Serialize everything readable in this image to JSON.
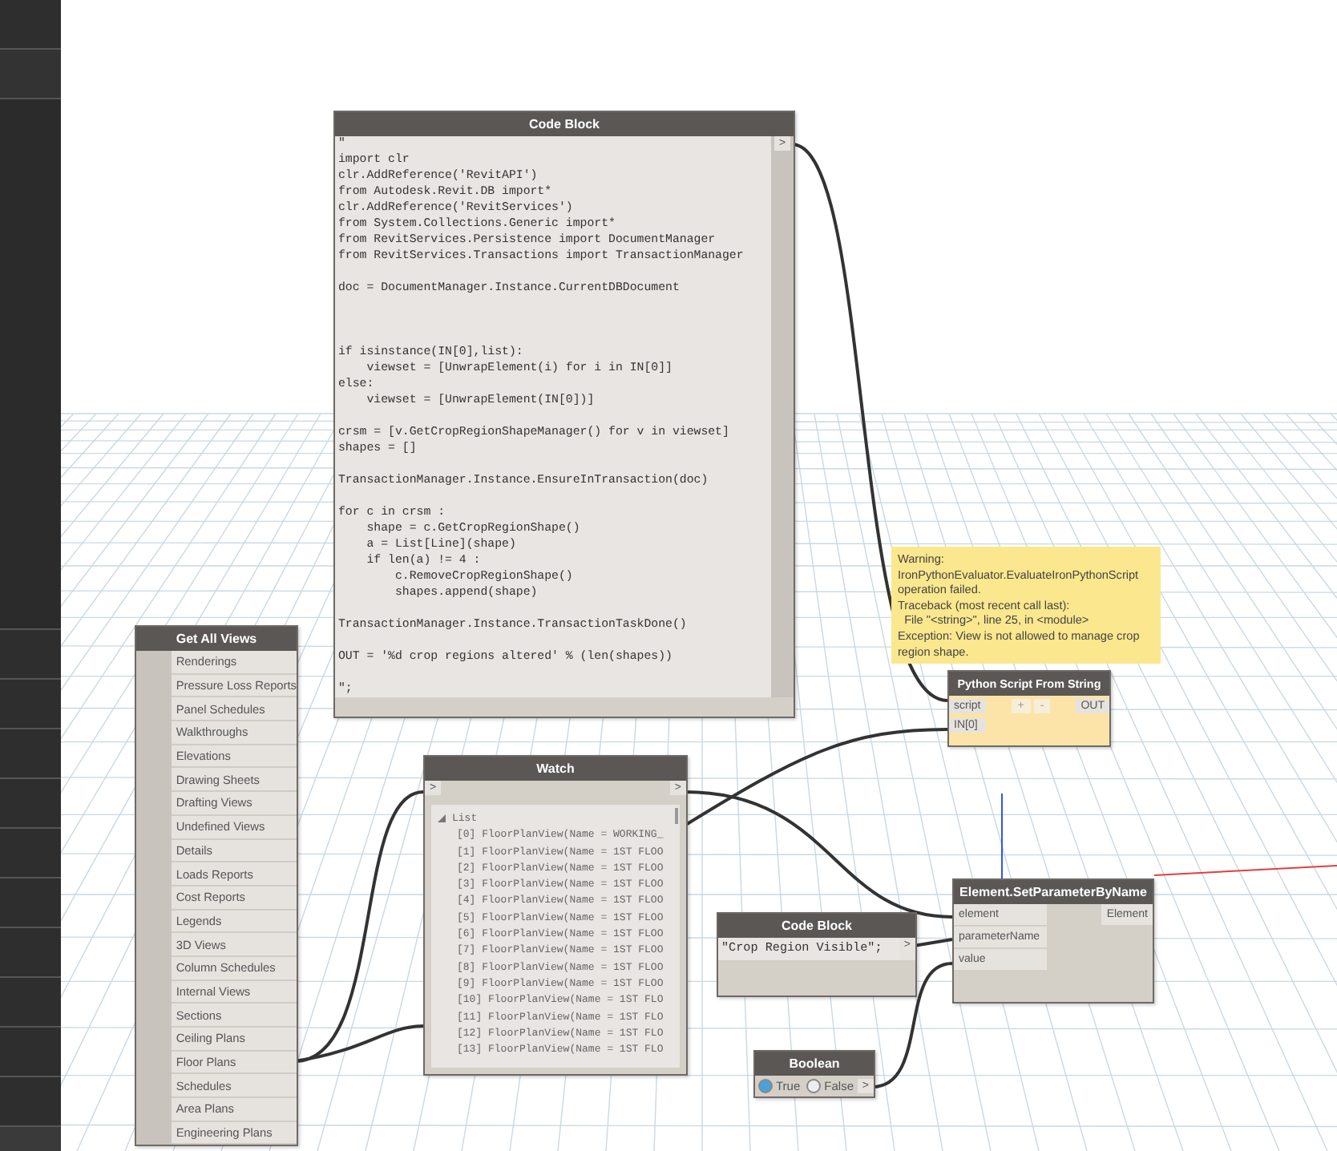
{
  "code_block": {
    "title": "Code Block",
    "output_port": ">",
    "code": "\"\nimport clr\nclr.AddReference('RevitAPI')\nfrom Autodesk.Revit.DB import*\nclr.AddReference('RevitServices')\nfrom System.Collections.Generic import*\nfrom RevitServices.Persistence import DocumentManager\nfrom RevitServices.Transactions import TransactionManager\n\ndoc = DocumentManager.Instance.CurrentDBDocument\n\n\n\nif isinstance(IN[0],list):\n    viewset = [UnwrapElement(i) for i in IN[0]]\nelse:\n    viewset = [UnwrapElement(IN[0])]\n\ncrsm = [v.GetCropRegionShapeManager() for v in viewset]\nshapes = []\n\nTransactionManager.Instance.EnsureInTransaction(doc)\n\nfor c in crsm :\n    shape = c.GetCropRegionShape()\n    a = List[Line](shape)\n    if len(a) != 4 :\n        c.RemoveCropRegionShape()\n        shapes.append(shape)\n\nTransactionManager.Instance.TransactionTaskDone()\n\nOUT = '%d crop regions altered' % (len(shapes))\n\n\";"
  },
  "get_all_views": {
    "title": "Get All Views",
    "items": [
      {
        "label": "Renderings"
      },
      {
        "label": "Pressure Loss Reports"
      },
      {
        "label": "Panel Schedules"
      },
      {
        "label": "Walkthroughs"
      },
      {
        "label": "Elevations"
      },
      {
        "label": "Drawing Sheets"
      },
      {
        "label": "Drafting Views"
      },
      {
        "label": "Undefined Views"
      },
      {
        "label": "Details"
      },
      {
        "label": "Loads Reports"
      },
      {
        "label": "Cost Reports"
      },
      {
        "label": "Legends"
      },
      {
        "label": "3D Views"
      },
      {
        "label": "Column Schedules"
      },
      {
        "label": "Internal Views"
      },
      {
        "label": "Sections"
      },
      {
        "label": "Ceiling Plans"
      },
      {
        "label": "Floor Plans"
      },
      {
        "label": "Schedules"
      },
      {
        "label": "Area Plans"
      },
      {
        "label": "Engineering Plans"
      }
    ]
  },
  "watch": {
    "title": "Watch",
    "input_port": ">",
    "output_port": ">",
    "root_label": "List",
    "expanded": true,
    "items": [
      "[0] FloorPlanView(Name = WORKING_",
      "[1] FloorPlanView(Name = 1ST FLOO",
      "[2] FloorPlanView(Name = 1ST FLOO",
      "[3] FloorPlanView(Name = 1ST FLOO",
      "[4] FloorPlanView(Name = 1ST FLOO",
      "[5] FloorPlanView(Name = 1ST FLOO",
      "[6] FloorPlanView(Name = 1ST FLOO",
      "[7] FloorPlanView(Name = 1ST FLOO",
      "[8] FloorPlanView(Name = 1ST FLOO",
      "[9] FloorPlanView(Name = 1ST FLOO",
      "[10] FloorPlanView(Name = 1ST FLO",
      "[11] FloorPlanView(Name = 1ST FLO",
      "[12] FloorPlanView(Name = 1ST FLO",
      "[13] FloorPlanView(Name = 1ST FLO"
    ]
  },
  "warning": {
    "lines": [
      "Warning:",
      "IronPythonEvaluator.EvaluateIronPythonScript operation failed.",
      "Traceback (most recent call last):",
      "  File \"<string>\", line 25, in <module>",
      "Exception: View is not allowed to manage crop region shape."
    ]
  },
  "python_node": {
    "title": "Python Script From String",
    "inputs": [
      "script",
      "IN[0]"
    ],
    "add_button": "+",
    "remove_button": "-",
    "output": "OUT"
  },
  "set_parameter": {
    "title": "Element.SetParameterByName",
    "inputs": [
      "element",
      "parameterName",
      "value"
    ],
    "output": "Element"
  },
  "string_block": {
    "title": "Code Block",
    "code": "\"Crop Region Visible\";",
    "output_port": ">"
  },
  "boolean": {
    "title": "Boolean",
    "options": [
      {
        "label": "True",
        "selected": true
      },
      {
        "label": "False",
        "selected": false
      }
    ],
    "output_port": ">"
  }
}
